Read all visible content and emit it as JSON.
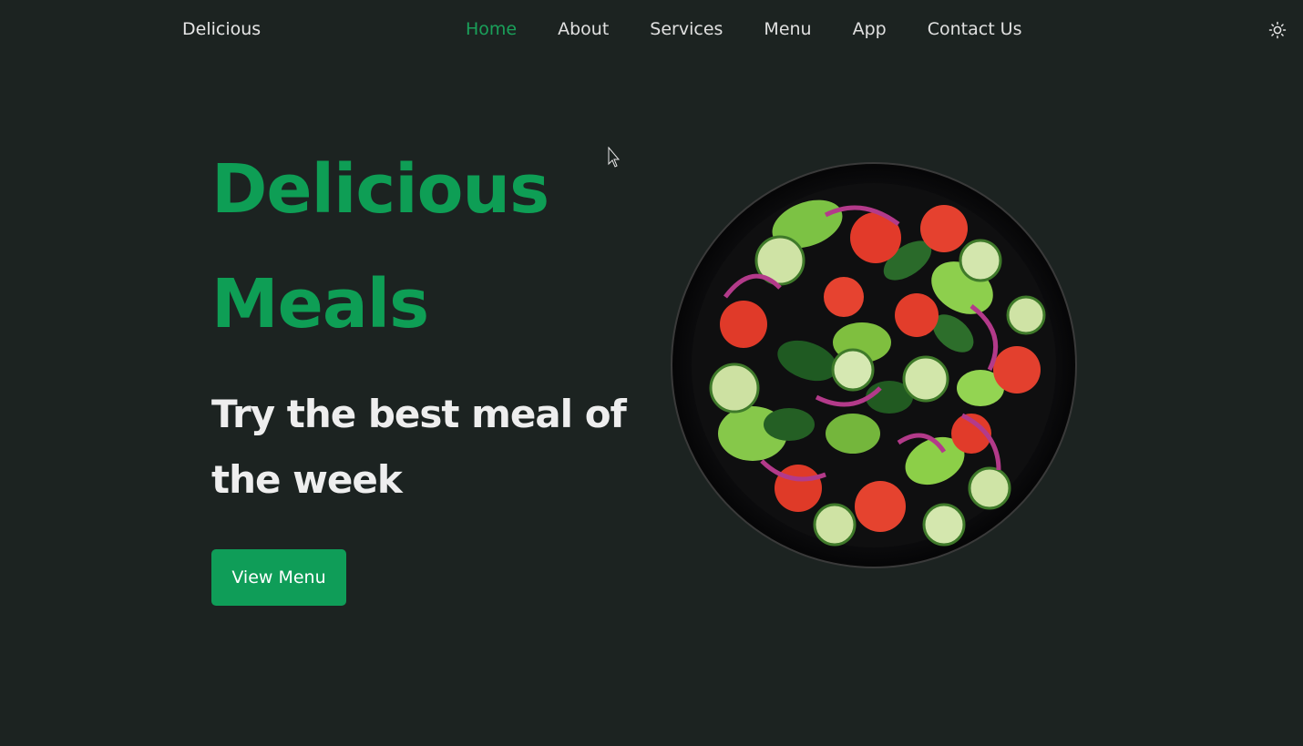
{
  "header": {
    "logo": "Delicious",
    "nav": [
      {
        "label": "Home",
        "active": true
      },
      {
        "label": "About",
        "active": false
      },
      {
        "label": "Services",
        "active": false
      },
      {
        "label": "Menu",
        "active": false
      },
      {
        "label": "App",
        "active": false
      },
      {
        "label": "Contact Us",
        "active": false
      }
    ],
    "theme_toggle_icon": "sun-icon"
  },
  "hero": {
    "title_line1": "Delicious",
    "title_line2": "Meals",
    "subtitle": "Try the best meal of the week",
    "cta_label": "View Menu",
    "image_icon": "salad-bowl-image"
  },
  "colors": {
    "background": "#1c2321",
    "accent": "#0f9d58",
    "text_primary": "#eeeeee",
    "nav_text": "#e0e0e0"
  }
}
